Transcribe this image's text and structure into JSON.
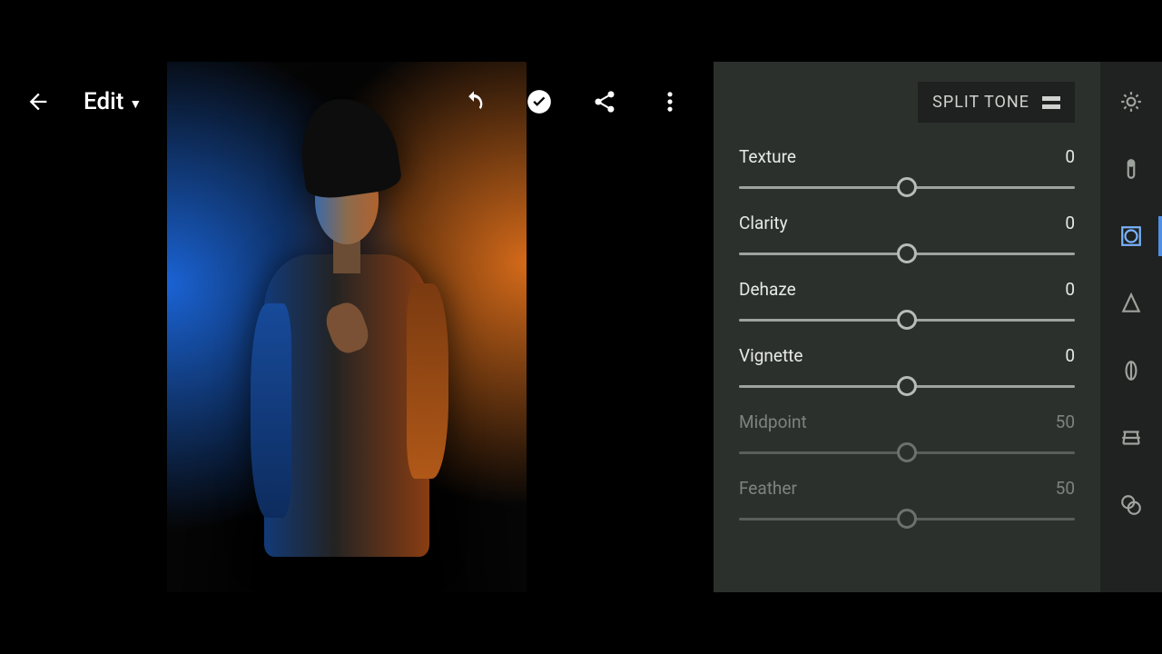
{
  "header": {
    "title": "Edit"
  },
  "panel": {
    "chip_label": "SPLIT TONE",
    "sliders": [
      {
        "label": "Texture",
        "value": "0",
        "pos": 50,
        "dim": false
      },
      {
        "label": "Clarity",
        "value": "0",
        "pos": 50,
        "dim": false
      },
      {
        "label": "Dehaze",
        "value": "0",
        "pos": 50,
        "dim": false
      },
      {
        "label": "Vignette",
        "value": "0",
        "pos": 50,
        "dim": false
      },
      {
        "label": "Midpoint",
        "value": "50",
        "pos": 50,
        "dim": true
      },
      {
        "label": "Feather",
        "value": "50",
        "pos": 50,
        "dim": true
      }
    ]
  },
  "rail": {
    "items": [
      {
        "name": "light-icon",
        "active": false
      },
      {
        "name": "color-icon",
        "active": false
      },
      {
        "name": "effects-icon",
        "active": true
      },
      {
        "name": "detail-icon",
        "active": false
      },
      {
        "name": "optics-icon",
        "active": false
      },
      {
        "name": "geometry-icon",
        "active": false
      },
      {
        "name": "presets-icon",
        "active": false
      }
    ]
  }
}
